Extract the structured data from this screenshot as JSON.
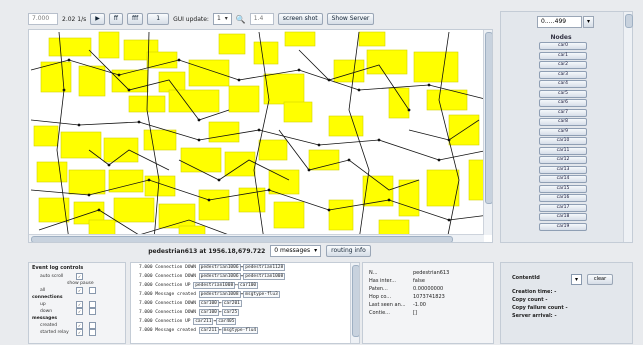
{
  "toolbar": {
    "sim_time": "7.000",
    "speed": "2.02 1/s",
    "play_icon": "play-icon",
    "ff_label": "ff",
    "fff_label": "fff",
    "step_field": "1",
    "gui_update_label": "GUI update:",
    "gui_update_value": "1",
    "zoom_icon": "zoom-icon",
    "zoom_value": "1.4",
    "screenshot_label": "screen shot",
    "show_server_label": "Show Server"
  },
  "status": {
    "text": "pedestrian613 at 1956.18,679.722",
    "messages_dropdown": "0 messages",
    "routing_info_label": "routing info"
  },
  "right_panel": {
    "group_select": "0..…499",
    "title": "Nodes",
    "nodes": [
      "car0",
      "car1",
      "car2",
      "car3",
      "car4",
      "car5",
      "car6",
      "car7",
      "car8",
      "car9",
      "car10",
      "car11",
      "car12",
      "car13",
      "car14",
      "car15",
      "car16",
      "car17",
      "car18",
      "car19"
    ]
  },
  "event_log_controls": {
    "title": "Event log controls",
    "auto_scroll": "auto scroll",
    "show": "show",
    "pause": "pause",
    "rows": [
      {
        "section": "all",
        "is_section": false
      },
      {
        "section": "connections",
        "is_section": true
      },
      {
        "section": "up",
        "is_section": false
      },
      {
        "section": "down",
        "is_section": false
      },
      {
        "section": "messages",
        "is_section": true
      },
      {
        "section": "created",
        "is_section": false
      },
      {
        "section": "started relay",
        "is_section": false
      }
    ]
  },
  "log": [
    {
      "time": "7.000",
      "text": "Connection DOWN",
      "a": "pedestrian1006",
      "b": "pedestrian1128"
    },
    {
      "time": "7.000",
      "text": "Connection DOWN",
      "a": "pedestrian1006",
      "b": "pedestrian1008"
    },
    {
      "time": "7.000",
      "text": "Connection UP",
      "a": "pedestrian1008",
      "b": "car100"
    },
    {
      "time": "7.000",
      "text": "Message created",
      "a": "pedestrian1008",
      "b": "msgtype-flu3"
    },
    {
      "time": "7.000",
      "text": "Connection DOWN",
      "a": "car100",
      "b": "car201"
    },
    {
      "time": "7.000",
      "text": "Connection DOWN",
      "a": "car100",
      "b": "car25"
    },
    {
      "time": "7.000",
      "text": "Connection UP",
      "a": "car211",
      "b": "car405"
    },
    {
      "time": "7.000",
      "text": "Message created",
      "a": "car211",
      "b": "msgtype-flu4"
    }
  ],
  "info": [
    {
      "k": "N...",
      "v": "pedestrian613"
    },
    {
      "k": "Has inter...",
      "v": "false"
    },
    {
      "k": "Paten...",
      "v": "0.00000000"
    },
    {
      "k": "Hop co...",
      "v": "1073741823"
    },
    {
      "k": "Last seen an...",
      "v": "-1.00"
    },
    {
      "k": "Contie...",
      "v": "[]"
    }
  ],
  "router_panel": {
    "content_id_label": "ContentId",
    "clear_label": "clear",
    "creation_time": "Creation time:",
    "creation_value": "-",
    "copy_count": "Copy count",
    "copy_count_value": "-",
    "copy_failure": "Copy failure count -",
    "server_arrival": "Server arrival:",
    "server_value": "-"
  },
  "colors": {
    "building": "#ffff00",
    "edge": "#111111",
    "bg": "#ffffff"
  }
}
